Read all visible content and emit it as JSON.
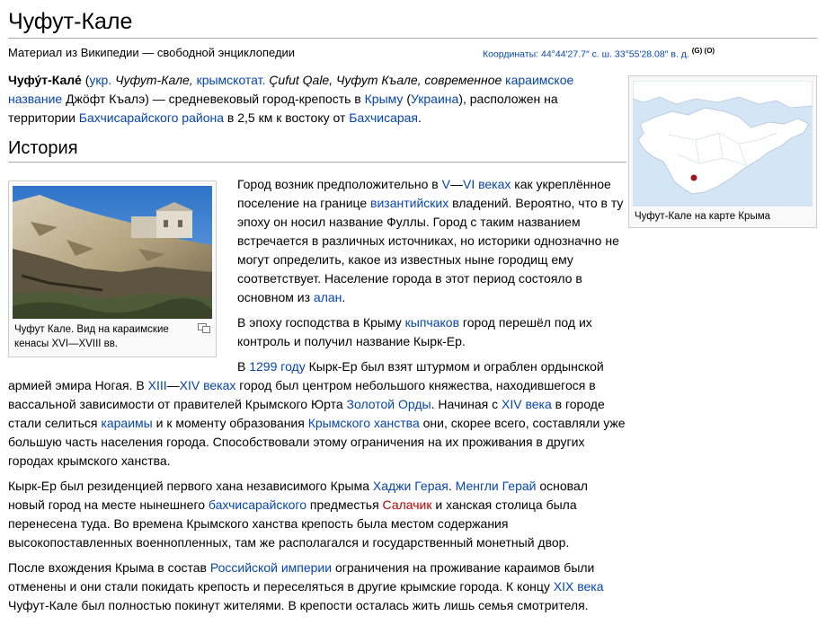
{
  "page": {
    "title": "Чуфут-Кале",
    "subtitle": "Материал из Википедии — свободной энциклопедии",
    "coords": {
      "label": "Координаты",
      "value": ": 44°44′27.7″ с. ш. 33°55′28.08″ в. д.",
      "sup": "(G) (O)"
    }
  },
  "intro": {
    "name_bold": "Чуфу́т-Кале́",
    "open": " (",
    "ukr": "укр.",
    "ukr_name": " Чуфут-Кале, ",
    "crimtat": "крымскотат.",
    "crimtat_name": " Çufut Qale, Чуфут Къале, современное ",
    "karaim": "караимское название",
    "karaim_name": " Джӧфт Къалэ) — средневековый город-крепость в ",
    "crimea": "Крыму",
    "sp1": " (",
    "ukraine": "Украина",
    "after_ukraine": "), расположен на территории ",
    "district": "Бахчисарайского района",
    "after_district": " в 2,5 км к востоку от ",
    "bakhch": "Бахчисарая",
    "end": "."
  },
  "history": {
    "heading": "История",
    "p1": {
      "t1": "Город возник предположительно в ",
      "l1": "V",
      "t2": "—",
      "l2": "VI веках",
      "t3": " как укреплённое поселение на границе ",
      "l3": "византийских",
      "t4": " владений. Вероятно, что в ту эпоху он носил название Фуллы. Город с таким названием встречается в различных источниках, но историки однозначно не могут определить, какое из известных ныне городищ ему соответствует. Население города в этот период состояло в основном из ",
      "l4": "алан",
      "t5": "."
    },
    "p2": {
      "t1": "В эпоху господства в Крыму ",
      "l1": "кыпчаков",
      "t2": " город перешёл под их контроль и получил название Кырк-Ер."
    },
    "p3": {
      "t1": "В ",
      "l1": "1299 году",
      "t2": " Кырк-Ер был взят штурмом и ограблен ордынской армией эмира Ногая. В ",
      "l2": "XIII",
      "t3": "—",
      "l3": "XIV веках",
      "t4": " город был центром небольшого княжества, находившегося в вассальной зависимости от правителей Крымского Юрта ",
      "l4": "Золотой Орды",
      "t5": ". Начиная с ",
      "l5": "XIV века",
      "t6": " в городе стали селиться ",
      "l6": "караимы",
      "t7": " и к моменту образования ",
      "l7": "Крымского ханства",
      "t8": " они, скорее всего, составляли уже большую часть населения города. Способствовали этому ограничения на их проживания в других городах крымского ханства."
    },
    "p4": {
      "t1": "Кырк-Ер был резиденцией первого хана независимого Крыма ",
      "l1": "Хаджи Герая",
      "t2": ". ",
      "l2": "Менгли Герай",
      "t3": " основал новый город на месте нынешнего ",
      "l3": "бахчисарайского",
      "t4": " предместья ",
      "l4": "Салачик",
      "t5": " и ханская столица была перенесена туда. Во времена Крымского ханства крепость была местом содержания высокопоставленных военнопленных, там же располагался и государственный монетный двор."
    },
    "p5": {
      "t1": "После вхождения Крыма в состав ",
      "l1": "Российской империи",
      "t2": " ограничения на проживание караимов были отменены и они стали покидать крепость и переселяться в другие крымские города. К концу ",
      "l2": "XIX века",
      "t3": " Чуфут-Кале был полностью покинут жителями. В крепости осталась жить лишь семья смотрителя."
    }
  },
  "thumbs": {
    "photo_caption": "Чуфут Кале. Вид на караимские кенасы XVI—XVIII вв.",
    "map_caption": "Чуфут-Кале на карте Крыма"
  },
  "colors": {
    "link": "#0645ad",
    "redlink": "#ba0000",
    "map_sea": "#d4e6f5",
    "map_land": "#ffffff"
  },
  "icons": [
    "magnify-icon",
    "location-pin-icon"
  ]
}
